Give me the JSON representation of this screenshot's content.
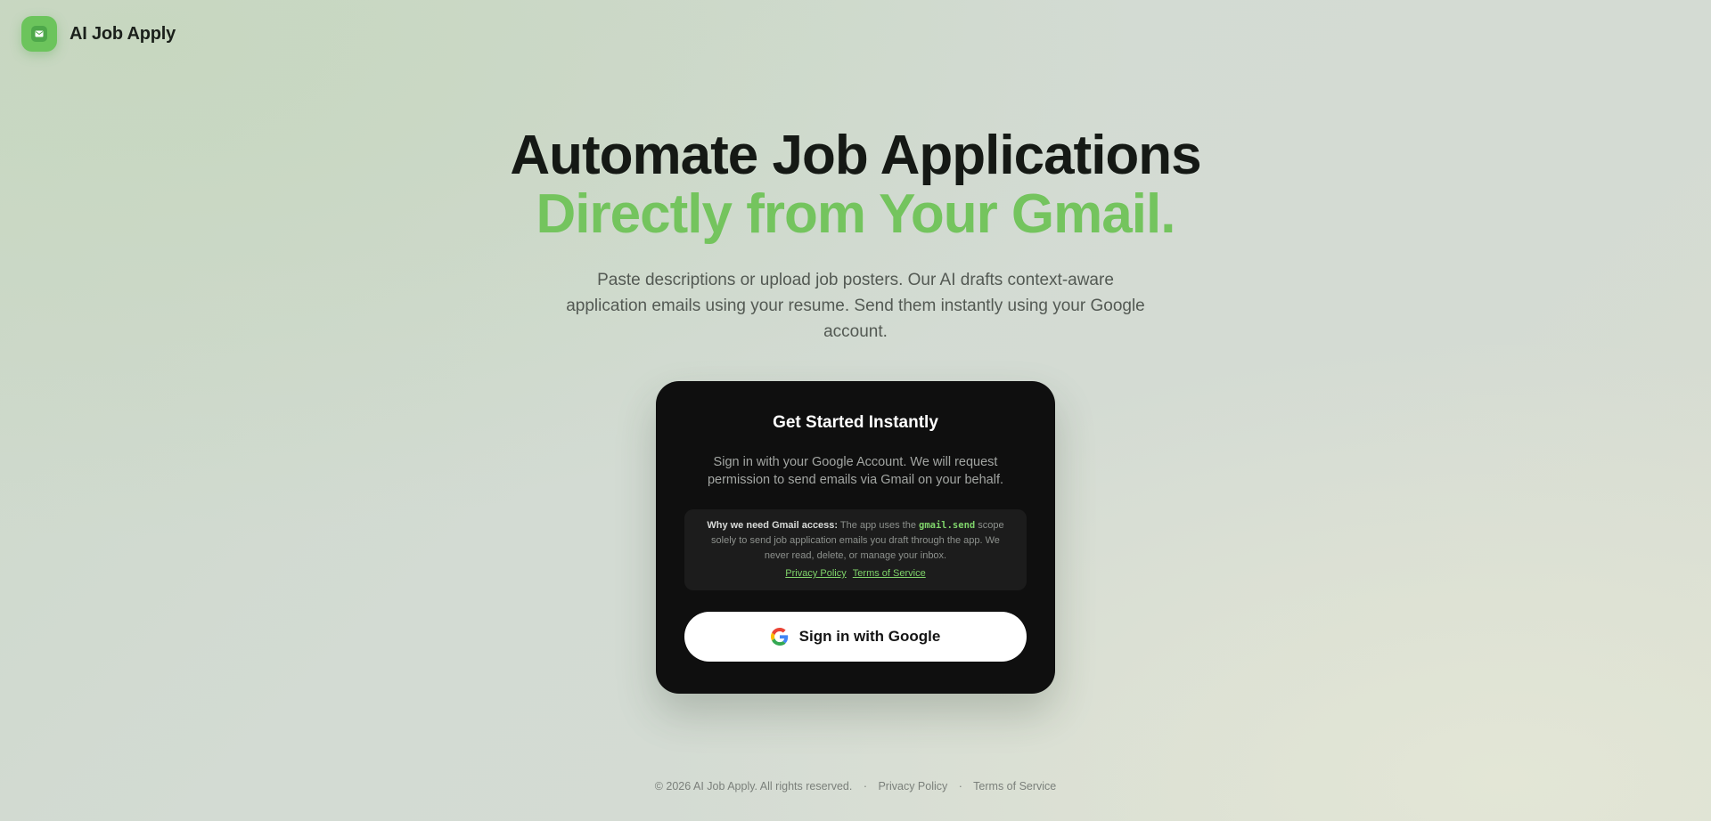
{
  "header": {
    "brand": "AI Job Apply",
    "logo_icon": "mail-icon",
    "accent_color": "#6cc45c"
  },
  "hero": {
    "title_line1": "Automate Job Applications",
    "title_line2": "Directly from Your Gmail.",
    "subtitle": "Paste descriptions or upload job posters. Our AI drafts context-aware application emails using your resume. Send them instantly using your Google account."
  },
  "card": {
    "title": "Get Started Instantly",
    "description": "Sign in with your Google Account. We will request permission to send emails via Gmail on your behalf.",
    "notice": {
      "label": "Why we need Gmail access:",
      "text_before": " The app uses the ",
      "scope": "gmail.send",
      "text_after": " scope solely to send job application emails you draft through the app. We never read, delete, or manage your inbox.",
      "privacy_link": "Privacy Policy",
      "terms_link": "Terms of Service"
    },
    "button_label": "Sign in with Google",
    "button_icon": "google-icon"
  },
  "footer": {
    "copyright": "© 2026 AI Job Apply. All rights reserved.",
    "separator": "·",
    "privacy": "Privacy Policy",
    "terms": "Terms of Service"
  }
}
